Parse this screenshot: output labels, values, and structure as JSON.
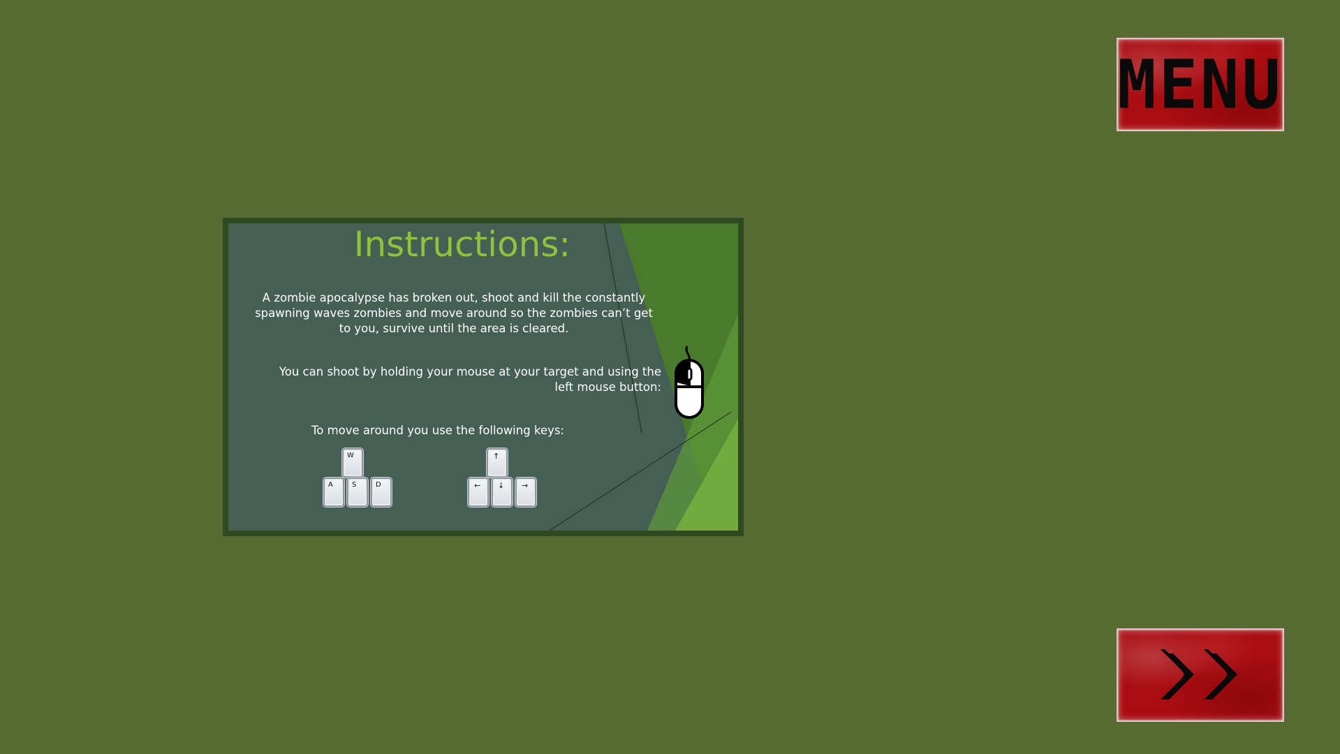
{
  "menu_button": {
    "label": "MENU"
  },
  "next_button": {
    "icon": "double-chevron-right"
  },
  "instructions": {
    "title": "Instructions:",
    "intro": "A zombie apocalypse has broken out, shoot and kill the constantly spawning waves zombies and move around so the zombies can’t get to you, survive until the area is cleared.",
    "shoot": "You can shoot by holding your mouse at your target and using the left mouse button:",
    "move": "To move around you use the following keys:",
    "mouse_icon": "mouse-left-button-icon",
    "wasd_keys": {
      "up": "W",
      "left": "A",
      "down": "S",
      "right": "D"
    },
    "arrow_keys": {
      "up": "↑",
      "left": "←",
      "down": "↓",
      "right": "→"
    }
  },
  "colors": {
    "background": "#576b32",
    "panel_border": "#2f4a21",
    "panel_fill": "#465f54",
    "title": "#8fc33c",
    "button_red": "#a90d12"
  }
}
